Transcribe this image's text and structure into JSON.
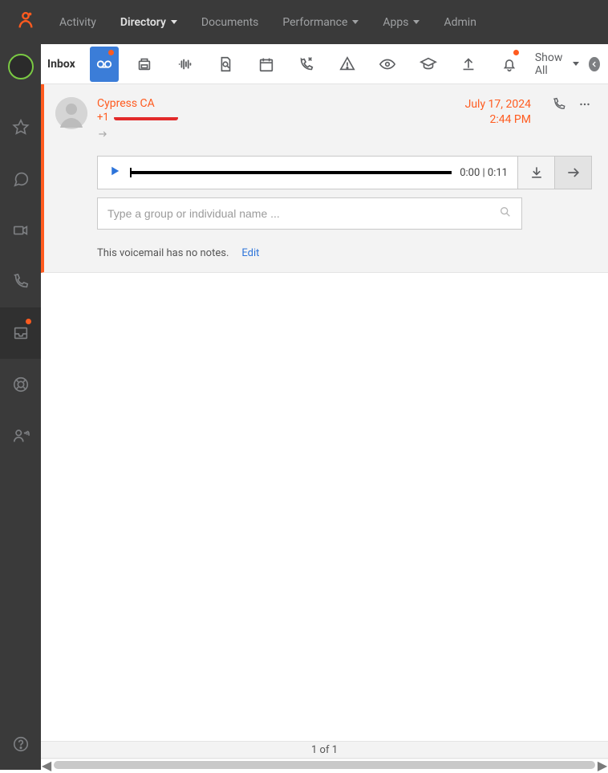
{
  "topnav": {
    "items": [
      {
        "label": "Activity",
        "dropdown": false
      },
      {
        "label": "Directory",
        "dropdown": true,
        "active": true
      },
      {
        "label": "Documents",
        "dropdown": false
      },
      {
        "label": "Performance",
        "dropdown": true
      },
      {
        "label": "Apps",
        "dropdown": true
      },
      {
        "label": "Admin",
        "dropdown": false
      }
    ]
  },
  "subbar": {
    "inbox_label": "Inbox",
    "show_all": "Show All"
  },
  "voicemail": {
    "name": "Cypress CA",
    "phone_prefix": "+1",
    "date": "July 17, 2024",
    "time": "2:44 PM",
    "elapsed": "0:00",
    "separator": "|",
    "duration": "0:11",
    "search_placeholder": "Type a group or individual name ...",
    "no_notes": "This voicemail has no notes.",
    "edit": "Edit"
  },
  "footer": {
    "pager": "1 of 1"
  }
}
